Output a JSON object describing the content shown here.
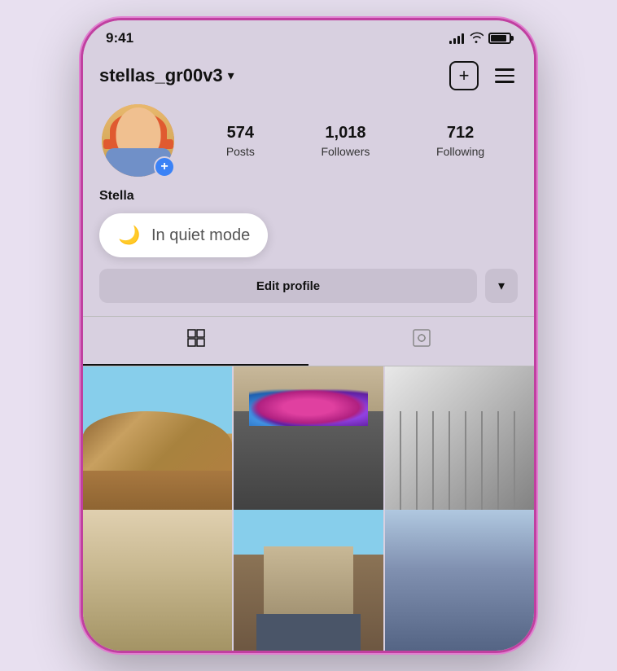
{
  "status": {
    "time": "9:41"
  },
  "header": {
    "username": "stellas_gr00v3",
    "add_icon": "+",
    "chevron": "▾"
  },
  "profile": {
    "name": "Stella",
    "stats": {
      "posts_count": "574",
      "posts_label": "Posts",
      "followers_count": "1,018",
      "followers_label": "Followers",
      "following_count": "712",
      "following_label": "Following"
    }
  },
  "quiet_mode": {
    "label": "In quiet mode"
  },
  "buttons": {
    "edit_profile": "Edit profile",
    "dropdown_icon": "▾"
  },
  "tabs": {
    "grid_label": "Grid",
    "tagged_label": "Tagged"
  }
}
